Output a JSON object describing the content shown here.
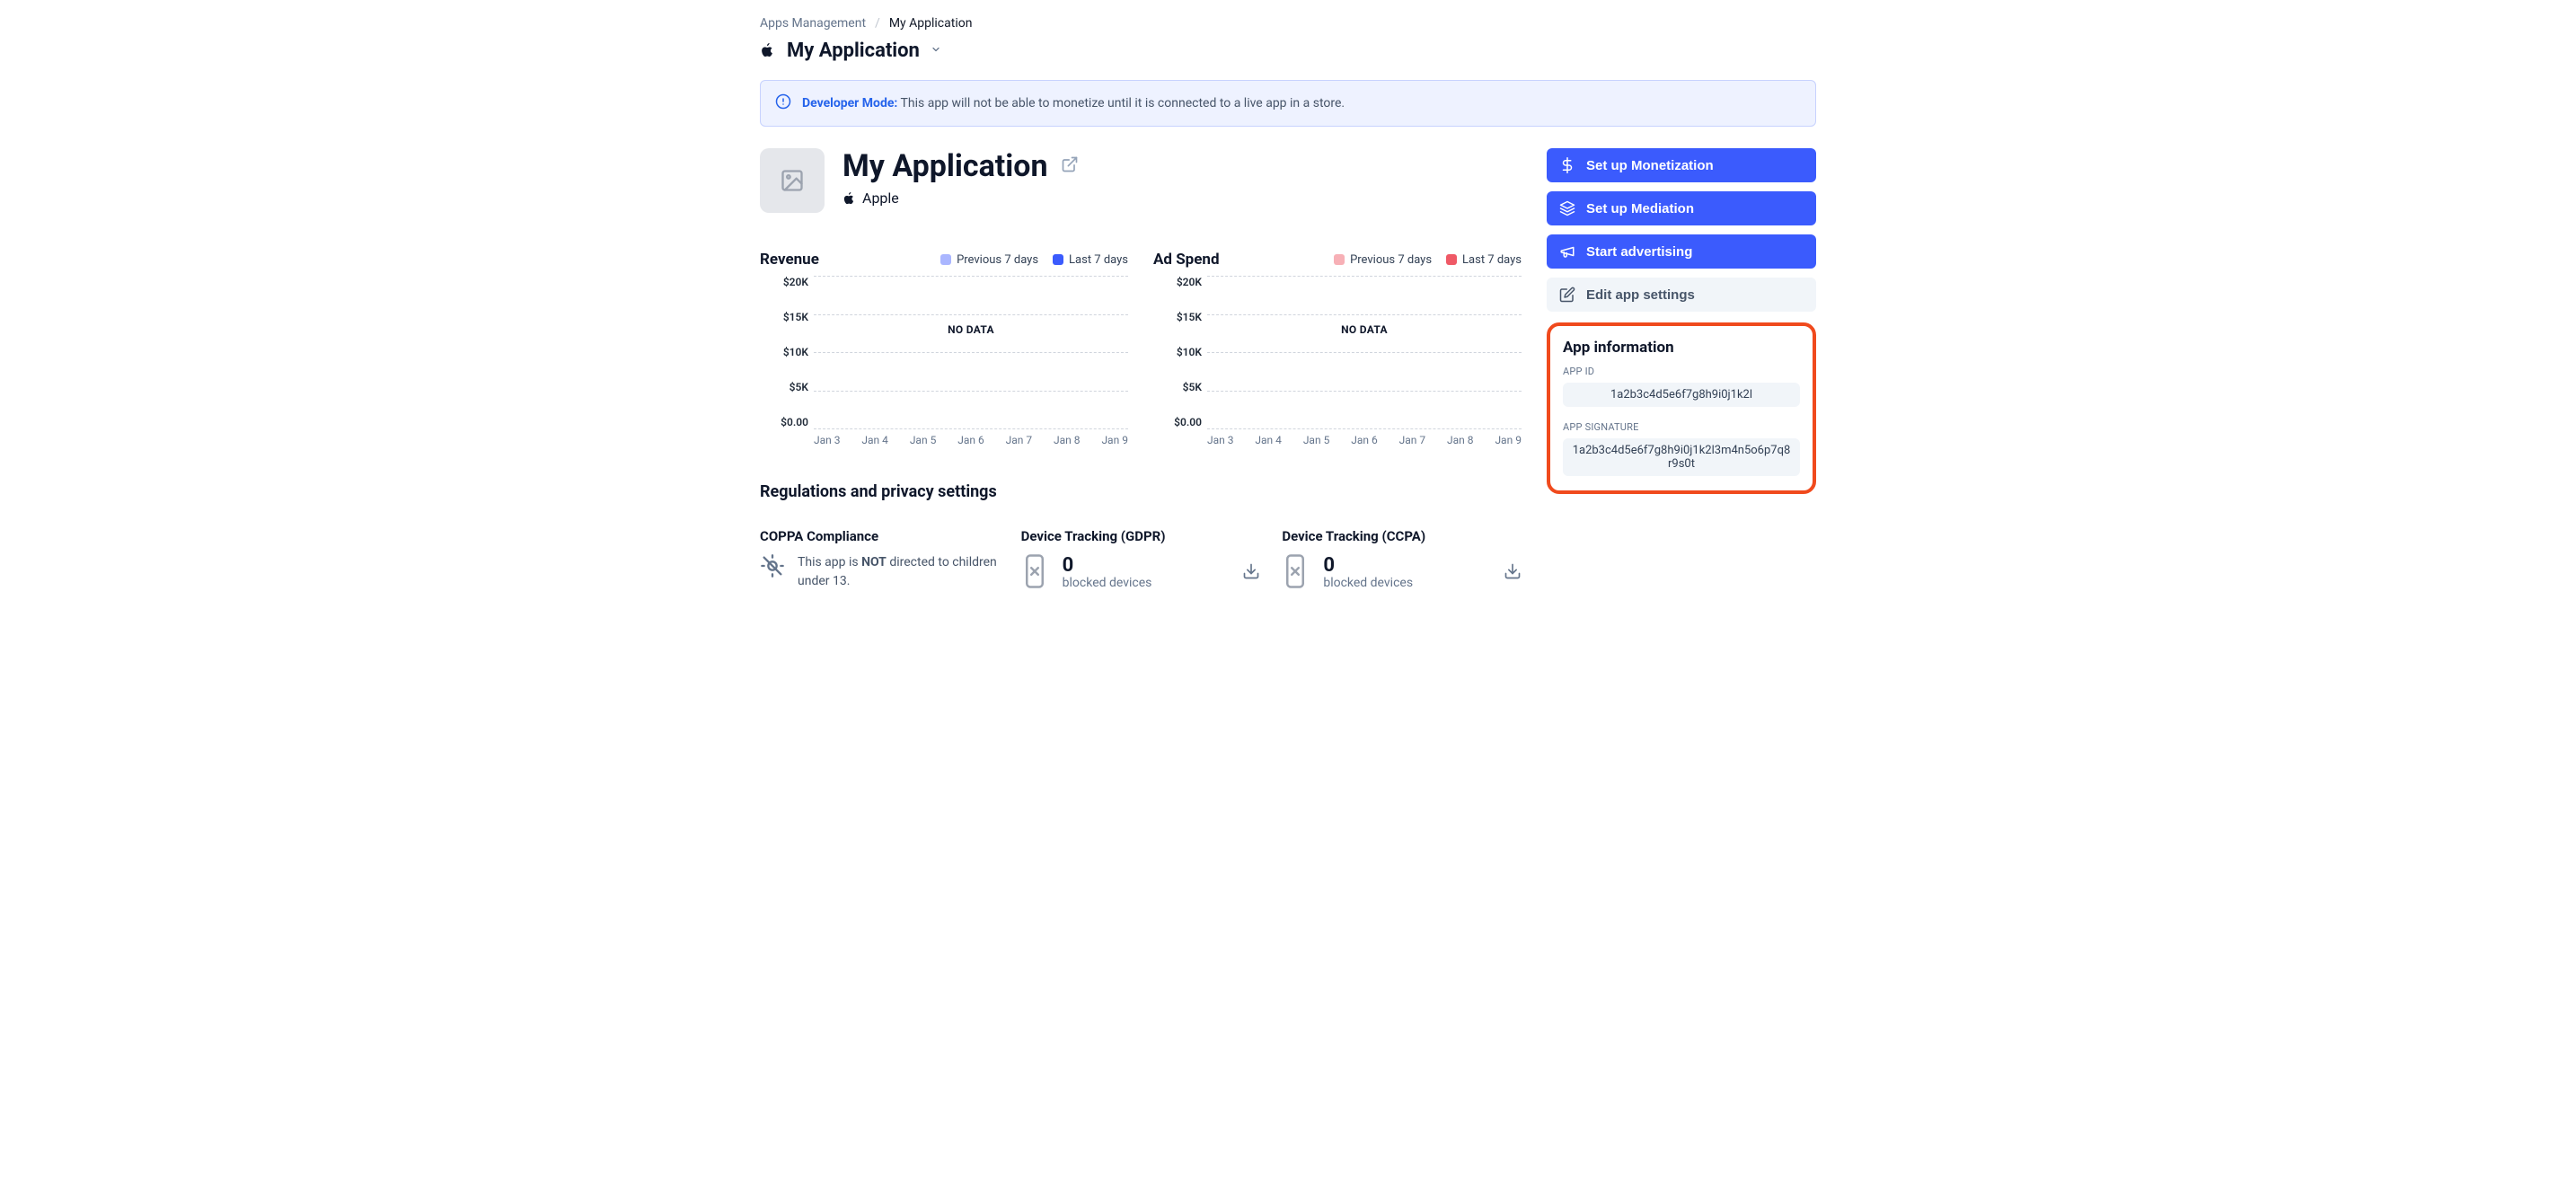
{
  "breadcrumb": {
    "root": "Apps Management",
    "leaf": "My Application"
  },
  "header": {
    "title": "My Application"
  },
  "banner": {
    "dev": "Developer Mode:",
    "msg": "This app will not be able to monetize until it is connected to a live app in a store."
  },
  "app": {
    "name": "My Application",
    "platform": "Apple"
  },
  "actions": {
    "monetization": "Set up Monetization",
    "mediation": "Set up Mediation",
    "advertising": "Start advertising",
    "edit": "Edit app settings"
  },
  "info": {
    "title": "App information",
    "app_id_label": "APP ID",
    "app_id": "1a2b3c4d5e6f7g8h9i0j1k2l",
    "signature_label": "APP SIGNATURE",
    "signature": "1a2b3c4d5e6f7g8h9i0j1k2l3m4n5o6p7q8r9s0t"
  },
  "chart_meta": {
    "revenue": {
      "title": "Revenue",
      "legend_prev": "Previous 7 days",
      "legend_last": "Last 7 days"
    },
    "adspend": {
      "title": "Ad Spend",
      "legend_prev": "Previous 7 days",
      "legend_last": "Last 7 days"
    },
    "nodata": "NO DATA",
    "y_ticks": [
      "$20K",
      "$15K",
      "$10K",
      "$5K",
      "$0.00"
    ],
    "x_ticks": [
      "Jan 3",
      "Jan 4",
      "Jan 5",
      "Jan 6",
      "Jan 7",
      "Jan 8",
      "Jan 9"
    ]
  },
  "chart_data": [
    {
      "type": "line",
      "title": "Revenue",
      "xlabel": "",
      "ylabel": "",
      "ylim": [
        0,
        20000
      ],
      "categories": [
        "Jan 3",
        "Jan 4",
        "Jan 5",
        "Jan 6",
        "Jan 7",
        "Jan 8",
        "Jan 9"
      ],
      "series": [
        {
          "name": "Previous 7 days",
          "values": [
            null,
            null,
            null,
            null,
            null,
            null,
            null
          ]
        },
        {
          "name": "Last 7 days",
          "values": [
            null,
            null,
            null,
            null,
            null,
            null,
            null
          ]
        }
      ],
      "empty": true
    },
    {
      "type": "line",
      "title": "Ad Spend",
      "xlabel": "",
      "ylabel": "",
      "ylim": [
        0,
        20000
      ],
      "categories": [
        "Jan 3",
        "Jan 4",
        "Jan 5",
        "Jan 6",
        "Jan 7",
        "Jan 8",
        "Jan 9"
      ],
      "series": [
        {
          "name": "Previous 7 days",
          "values": [
            null,
            null,
            null,
            null,
            null,
            null,
            null
          ]
        },
        {
          "name": "Last 7 days",
          "values": [
            null,
            null,
            null,
            null,
            null,
            null,
            null
          ]
        }
      ],
      "empty": true
    }
  ],
  "regulations": {
    "title": "Regulations and privacy settings",
    "coppa_title": "COPPA Compliance",
    "coppa_prefix": "This app is ",
    "coppa_not": "NOT",
    "coppa_suffix": " directed to children under 13.",
    "gdpr_title": "Device Tracking (GDPR)",
    "ccpa_title": "Device Tracking (CCPA)",
    "blocked_value": "0",
    "blocked_label": "blocked devices"
  }
}
